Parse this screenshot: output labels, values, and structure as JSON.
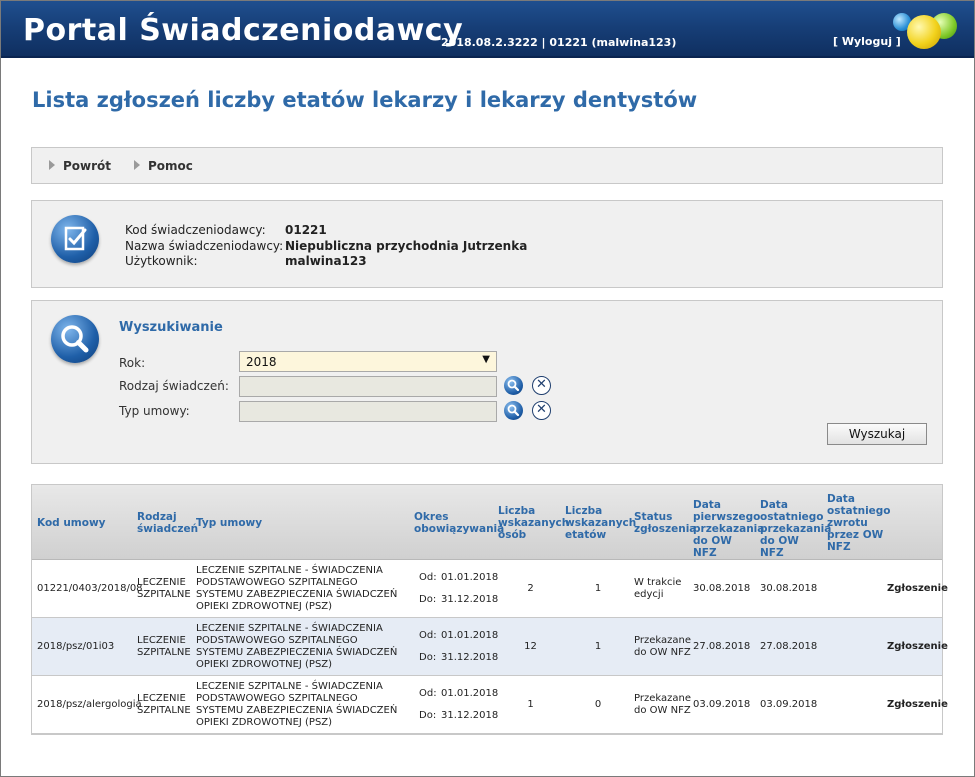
{
  "header": {
    "title": "Portal Świadczeniodawcy",
    "version": "2018.08.2.3222 | 01221 (malwina123)",
    "logout": "[ Wyloguj ]"
  },
  "page_title": "Lista zgłoszeń liczby etatów lekarzy i lekarzy dentystów",
  "nav": {
    "back": "Powrót",
    "help": "Pomoc"
  },
  "info": {
    "code_label": "Kod świadczeniodawcy:",
    "code_value": "01221",
    "name_label": "Nazwa świadczeniodawcy:",
    "name_value": "Niepubliczna przychodnia Jutrzenka",
    "user_label": "Użytkownik:",
    "user_value": "malwina123"
  },
  "search": {
    "heading": "Wyszukiwanie",
    "year_label": "Rok:",
    "year_value": "2018",
    "service_label": "Rodzaj świadczeń:",
    "service_value": "",
    "contract_label": "Typ umowy:",
    "contract_value": "",
    "search_button": "Wyszukaj"
  },
  "table": {
    "columns": {
      "kod": "Kod umowy",
      "rodzaj": "Rodzaj świadczeń",
      "typ": "Typ umowy",
      "okres": "Okres obowiązywania",
      "osob": "Liczba wskazanych osób",
      "etatow": "Liczba wskazanych etatów",
      "status": "Status zgłoszenia",
      "pierwsza": "Data pierwszego przekazania do OW NFZ",
      "ostatnia": "Data ostatniego przekazania do OW NFZ",
      "zwrot": "Data ostatniego zwrotu przez OW NFZ"
    },
    "rows": [
      {
        "kod": "01221/0403/2018/08",
        "rodzaj": "LECZENIE SZPITALNE",
        "typ": "LECZENIE SZPITALNE - ŚWIADCZENIA PODSTAWOWEGO SZPITALNEGO SYSTEMU ZABEZPIECZENIA ŚWIADCZEŃ OPIEKI ZDROWOTNEJ (PSZ)",
        "od_label": "Od:",
        "od": "01.01.2018",
        "do_label": "Do:",
        "do": "31.12.2018",
        "osob": "2",
        "etatow": "1",
        "status": "W trakcie edycji",
        "pierwsza": "30.08.2018",
        "ostatnia": "30.08.2018",
        "zwrot": "",
        "akcja": "Zgłoszenie"
      },
      {
        "kod": "2018/psz/01i03",
        "rodzaj": "LECZENIE SZPITALNE",
        "typ": "LECZENIE SZPITALNE - ŚWIADCZENIA PODSTAWOWEGO SZPITALNEGO SYSTEMU ZABEZPIECZENIA ŚWIADCZEŃ OPIEKI ZDROWOTNEJ (PSZ)",
        "od_label": "Od:",
        "od": "01.01.2018",
        "do_label": "Do:",
        "do": "31.12.2018",
        "osob": "12",
        "etatow": "1",
        "status": "Przekazane do OW NFZ",
        "pierwsza": "27.08.2018",
        "ostatnia": "27.08.2018",
        "zwrot": "",
        "akcja": "Zgłoszenie"
      },
      {
        "kod": "2018/psz/alergologia",
        "rodzaj": "LECZENIE SZPITALNE",
        "typ": "LECZENIE SZPITALNE - ŚWIADCZENIA PODSTAWOWEGO SZPITALNEGO SYSTEMU ZABEZPIECZENIA ŚWIADCZEŃ OPIEKI ZDROWOTNEJ (PSZ)",
        "od_label": "Od:",
        "od": "01.01.2018",
        "do_label": "Do:",
        "do": "31.12.2018",
        "osob": "1",
        "etatow": "0",
        "status": "Przekazane do OW NFZ",
        "pierwsza": "03.09.2018",
        "ostatnia": "03.09.2018",
        "zwrot": "",
        "akcja": "Zgłoszenie"
      }
    ]
  }
}
